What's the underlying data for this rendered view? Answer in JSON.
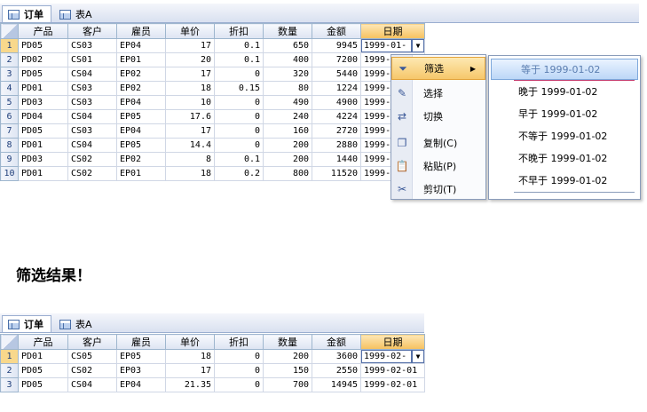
{
  "tabs": [
    {
      "label": "订单",
      "active": true
    },
    {
      "label": "表A",
      "active": false
    }
  ],
  "columns": [
    "产品",
    "客户",
    "雇员",
    "单价",
    "折扣",
    "数量",
    "金额",
    "日期"
  ],
  "top_grid": {
    "rows": [
      {
        "n": "1",
        "p": "PD05",
        "c": "CS03",
        "e": "EP04",
        "price": "17",
        "disc": "0.1",
        "qty": "650",
        "amt": "9945",
        "date": "1999-01-"
      },
      {
        "n": "2",
        "p": "PD02",
        "c": "CS01",
        "e": "EP01",
        "price": "20",
        "disc": "0.1",
        "qty": "400",
        "amt": "7200",
        "date": "1999-"
      },
      {
        "n": "3",
        "p": "PD05",
        "c": "CS04",
        "e": "EP02",
        "price": "17",
        "disc": "0",
        "qty": "320",
        "amt": "5440",
        "date": "1999-"
      },
      {
        "n": "4",
        "p": "PD01",
        "c": "CS03",
        "e": "EP02",
        "price": "18",
        "disc": "0.15",
        "qty": "80",
        "amt": "1224",
        "date": "1999-"
      },
      {
        "n": "5",
        "p": "PD03",
        "c": "CS03",
        "e": "EP04",
        "price": "10",
        "disc": "0",
        "qty": "490",
        "amt": "4900",
        "date": "1999-"
      },
      {
        "n": "6",
        "p": "PD04",
        "c": "CS04",
        "e": "EP05",
        "price": "17.6",
        "disc": "0",
        "qty": "240",
        "amt": "4224",
        "date": "1999-"
      },
      {
        "n": "7",
        "p": "PD05",
        "c": "CS03",
        "e": "EP04",
        "price": "17",
        "disc": "0",
        "qty": "160",
        "amt": "2720",
        "date": "1999-"
      },
      {
        "n": "8",
        "p": "PD01",
        "c": "CS04",
        "e": "EP05",
        "price": "14.4",
        "disc": "0",
        "qty": "200",
        "amt": "2880",
        "date": "1999-"
      },
      {
        "n": "9",
        "p": "PD03",
        "c": "CS02",
        "e": "EP02",
        "price": "8",
        "disc": "0.1",
        "qty": "200",
        "amt": "1440",
        "date": "1999-"
      },
      {
        "n": "10",
        "p": "PD01",
        "c": "CS02",
        "e": "EP01",
        "price": "18",
        "disc": "0.2",
        "qty": "800",
        "amt": "11520",
        "date": "1999-"
      }
    ]
  },
  "context_menu": {
    "items": [
      {
        "label": "筛选",
        "icon": "filter-icon",
        "has_submenu": true
      },
      {
        "label": "选择",
        "icon": "select-icon"
      },
      {
        "label": "切换",
        "icon": "toggle-icon"
      },
      {
        "label": "复制(C)",
        "icon": "copy-icon"
      },
      {
        "label": "粘贴(P)",
        "icon": "paste-icon"
      },
      {
        "label": "剪切(T)",
        "icon": "cut-icon"
      }
    ]
  },
  "filter_submenu": {
    "items": [
      "等于 1999-01-02",
      "晚于 1999-01-02",
      "早于 1999-01-02",
      "不等于 1999-01-02",
      "不晚于 1999-01-02",
      "不早于 1999-01-02"
    ]
  },
  "result_heading": "筛选结果！",
  "bottom_grid": {
    "rows": [
      {
        "n": "1",
        "p": "PD01",
        "c": "CS05",
        "e": "EP05",
        "price": "18",
        "disc": "0",
        "qty": "200",
        "amt": "3600",
        "date": "1999-02-"
      },
      {
        "n": "2",
        "p": "PD05",
        "c": "CS02",
        "e": "EP03",
        "price": "17",
        "disc": "0",
        "qty": "150",
        "amt": "2550",
        "date": "1999-02-01"
      },
      {
        "n": "3",
        "p": "PD05",
        "c": "CS04",
        "e": "EP04",
        "price": "21.35",
        "disc": "0",
        "qty": "700",
        "amt": "14945",
        "date": "1999-02-01"
      }
    ]
  },
  "colors": {
    "accent": "#f6c15e",
    "header_blue": "#dde4f2",
    "submenu_underline": "#c23b6e"
  }
}
